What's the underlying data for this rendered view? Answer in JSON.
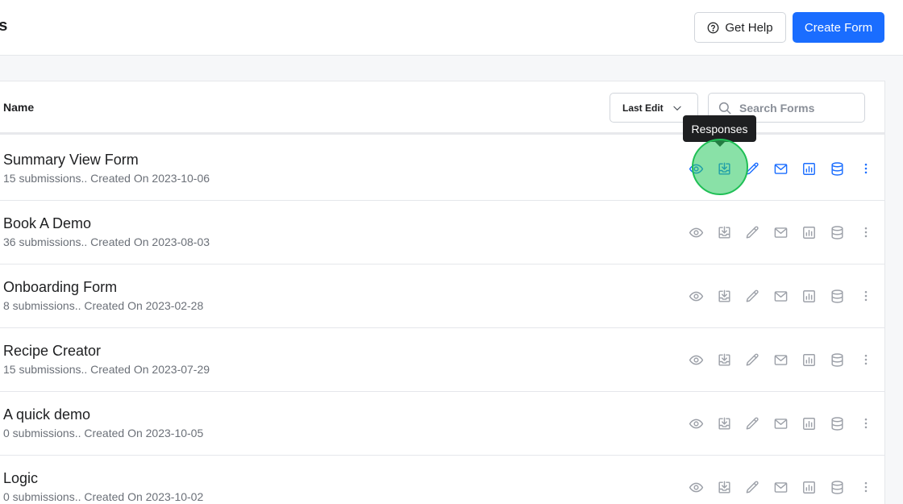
{
  "header": {
    "title": "ns",
    "help_label": "Get Help",
    "create_label": "Create Form"
  },
  "table": {
    "name_header": "Name",
    "sort_value": "Last Edit",
    "search_placeholder": "Search Forms"
  },
  "tooltip": "Responses",
  "forms": [
    {
      "title": "Summary View Form",
      "meta": "15 submissions.. Created On 2023-10-06"
    },
    {
      "title": "Book A Demo",
      "meta": "36 submissions.. Created On 2023-08-03"
    },
    {
      "title": "Onboarding Form",
      "meta": "8 submissions.. Created On 2023-02-28"
    },
    {
      "title": "Recipe Creator",
      "meta": "15 submissions.. Created On 2023-07-29"
    },
    {
      "title": "A quick demo",
      "meta": "0 submissions.. Created On 2023-10-05"
    },
    {
      "title": "Logic",
      "meta": "0 submissions.. Created On 2023-10-02"
    }
  ],
  "row_actions": [
    "eye-icon",
    "inbox-download-icon",
    "pencil-icon",
    "mail-icon",
    "chart-icon",
    "database-icon",
    "more-vertical-icon"
  ],
  "colors": {
    "accent": "#1a6dff",
    "icon_muted": "#9ca0a8",
    "click_highlight": "#28c95e",
    "tooltip_bg": "#1e1f21"
  }
}
